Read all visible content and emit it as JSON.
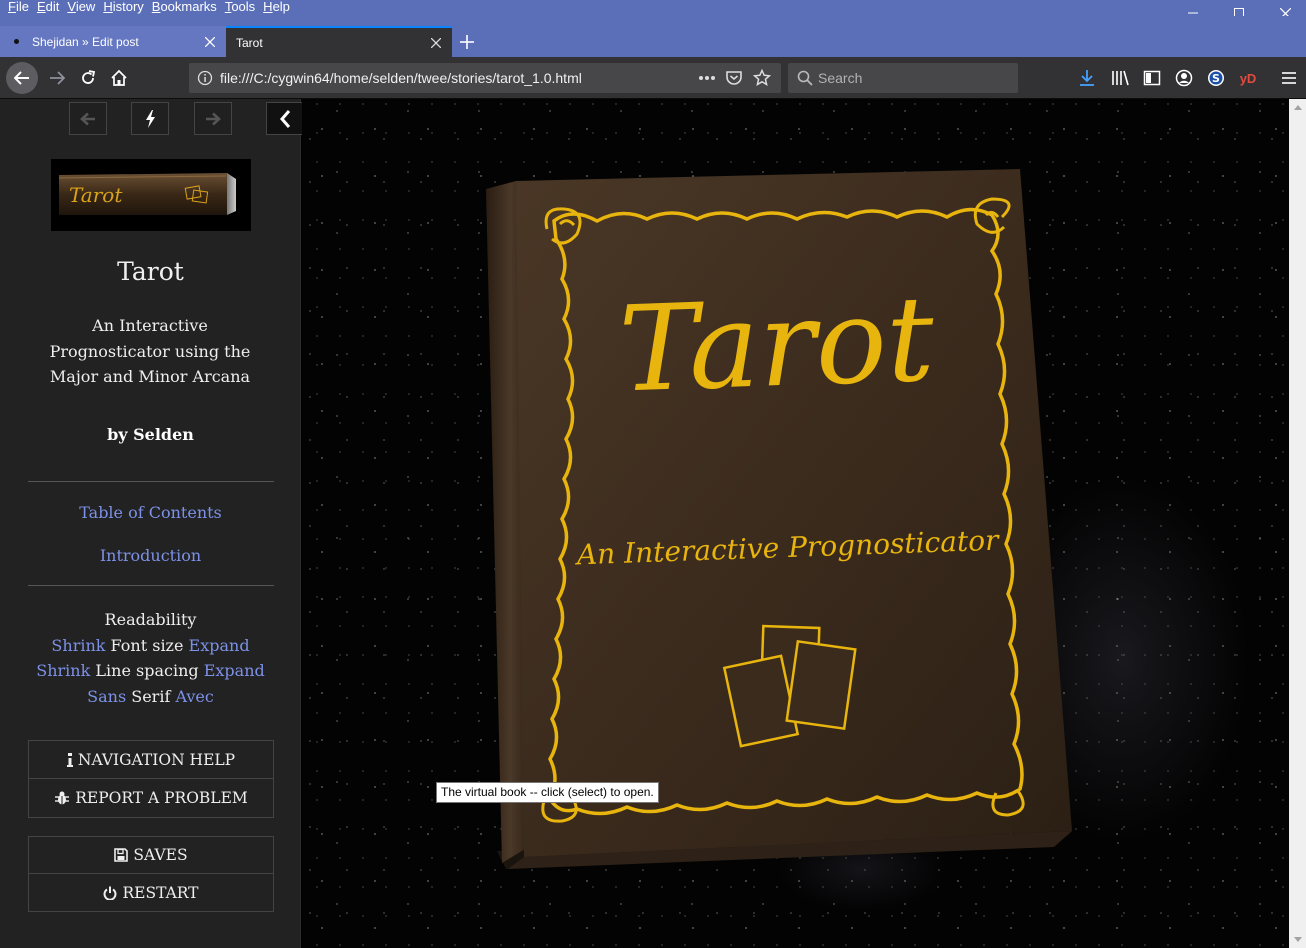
{
  "menubar": {
    "items": [
      "File",
      "Edit",
      "View",
      "History",
      "Bookmarks",
      "Tools",
      "Help"
    ]
  },
  "tabs": [
    {
      "title": "Shejidan » Edit post",
      "active": false
    },
    {
      "title": "Tarot",
      "active": true
    }
  ],
  "navbar": {
    "url": "file:///C:/cygwin64/home/selden/twee/stories/tarot_1.0.html",
    "search_placeholder": "Search",
    "yd_label": "yD"
  },
  "sidebar": {
    "banner_text": "Tarot",
    "title": "Tarot",
    "subtitle": "An Interactive Prognosticator using the Major and Minor Arcana",
    "author": "by Selden",
    "toc_link": "Table of Contents",
    "intro_link": "Introduction",
    "readability": {
      "heading": "Readability",
      "font_shrink": "Shrink",
      "font_label": "Font size",
      "font_expand": "Expand",
      "spacing_shrink": "Shrink",
      "spacing_label": "Line spacing",
      "spacing_expand": "Expand",
      "sans": "Sans",
      "serif": "Serif",
      "avec": "Avec"
    },
    "menu": {
      "nav_help": "NAVIGATION HELP",
      "report": "REPORT A PROBLEM",
      "saves": "SAVES",
      "restart": "RESTART"
    }
  },
  "book": {
    "title": "Tarot",
    "subtitle": "An Interactive Prognosticator"
  },
  "tooltip": "The virtual book -- click (select) to open.",
  "colors": {
    "chrome_blue": "#5b6fb8",
    "toolbar": "#323234",
    "sidebar_bg": "#222222",
    "link": "#7c91e8",
    "gold": "#e8b40e",
    "leather": "#3b2a1d"
  }
}
